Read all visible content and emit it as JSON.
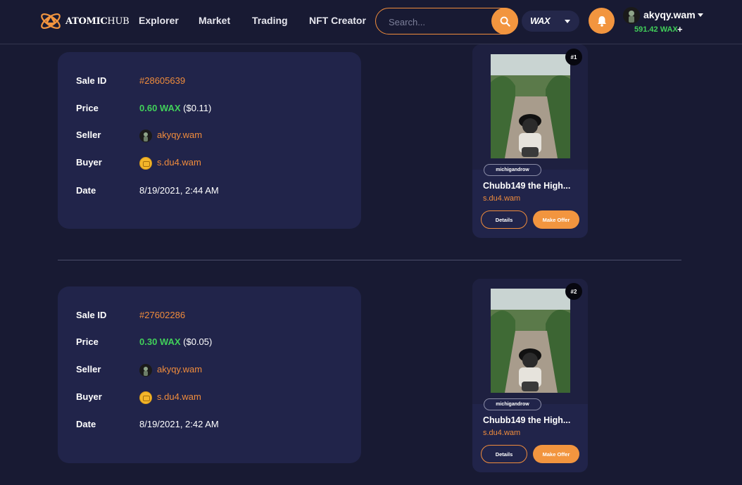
{
  "header": {
    "logo_text_bold": "ATOMIC",
    "logo_text_light": "HUB",
    "nav": [
      {
        "label": "Explorer"
      },
      {
        "label": "Market"
      },
      {
        "label": "Trading"
      },
      {
        "label": "NFT Creator"
      }
    ],
    "search_placeholder": "Search...",
    "chain_label": "WAX",
    "user": {
      "name": "akyqy.wam",
      "balance": "591.42 WAX",
      "add_funds": "+"
    }
  },
  "sales": [
    {
      "labels": {
        "sale_id": "Sale ID",
        "price": "Price",
        "seller": "Seller",
        "buyer": "Buyer",
        "date": "Date"
      },
      "sale_id": "#28605639",
      "price_wax": "0.60 WAX",
      "price_usd": "($0.11)",
      "seller": "akyqy.wam",
      "buyer": "s.du4.wam",
      "date": "8/19/2021, 2:44 AM",
      "nft": {
        "mint": "#1",
        "collection": "michigandrow",
        "name": "Chubb149 the High...",
        "owner": "s.du4.wam",
        "details_label": "Details",
        "offer_label": "Make Offer"
      }
    },
    {
      "labels": {
        "sale_id": "Sale ID",
        "price": "Price",
        "seller": "Seller",
        "buyer": "Buyer",
        "date": "Date"
      },
      "sale_id": "#27602286",
      "price_wax": "0.30 WAX",
      "price_usd": "($0.05)",
      "seller": "akyqy.wam",
      "buyer": "s.du4.wam",
      "date": "8/19/2021, 2:42 AM",
      "nft": {
        "mint": "#2",
        "collection": "michigandrow",
        "name": "Chubb149 the High...",
        "owner": "s.du4.wam",
        "details_label": "Details",
        "offer_label": "Make Offer"
      }
    }
  ],
  "colors": {
    "background": "#181a33",
    "card": "#21244a",
    "accent": "#f2953f",
    "link": "#f08c3c",
    "price": "#41d05a"
  },
  "icons": [
    "atom-logo-icon",
    "search-icon",
    "chevron-down-icon",
    "bell-icon",
    "avatar-icon",
    "coin-icon"
  ]
}
